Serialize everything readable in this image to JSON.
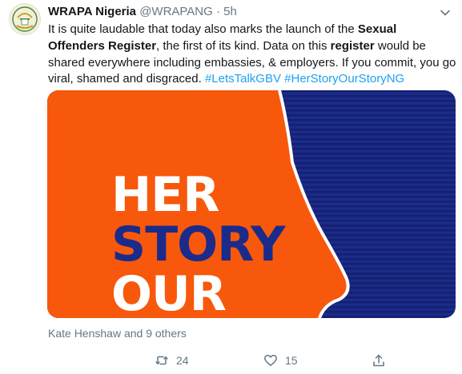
{
  "tweet": {
    "author_name": "WRAPA Nigeria",
    "handle": "@WRAPANG",
    "separator": "·",
    "time": "5h",
    "text": {
      "p1": "It is quite laudable that today also marks the launch of the ",
      "b1": "Sexual",
      "p2": " ",
      "b2": "Offenders Register",
      "p3": ", the first of its kind. Data on this ",
      "b3": "register",
      "p4": " would be shared everywhere including embassies, & employers. If you commit, you go viral, shamed and disgraced. ",
      "tag1": "#LetsTalkGBV",
      "p5": " ",
      "tag2": "#HerStoryOurStoryNG"
    },
    "media": {
      "word1": "HER",
      "word2": "STORY",
      "word3": "OUR",
      "colors": {
        "orange": "#f7580c",
        "navy": "#1b2b8a",
        "navy_dark": "#14206e"
      }
    },
    "likers": "Kate Henshaw and 9 others",
    "actions": {
      "retweets": "24",
      "likes": "15"
    },
    "icons": {
      "avatar": "wrapa-logo-icon",
      "caret": "chevron-down-icon",
      "retweet": "retweet-icon",
      "like": "heart-icon",
      "share": "share-icon"
    },
    "colors": {
      "link": "#1da1f2",
      "muted": "#657786",
      "text": "#14171a"
    }
  }
}
